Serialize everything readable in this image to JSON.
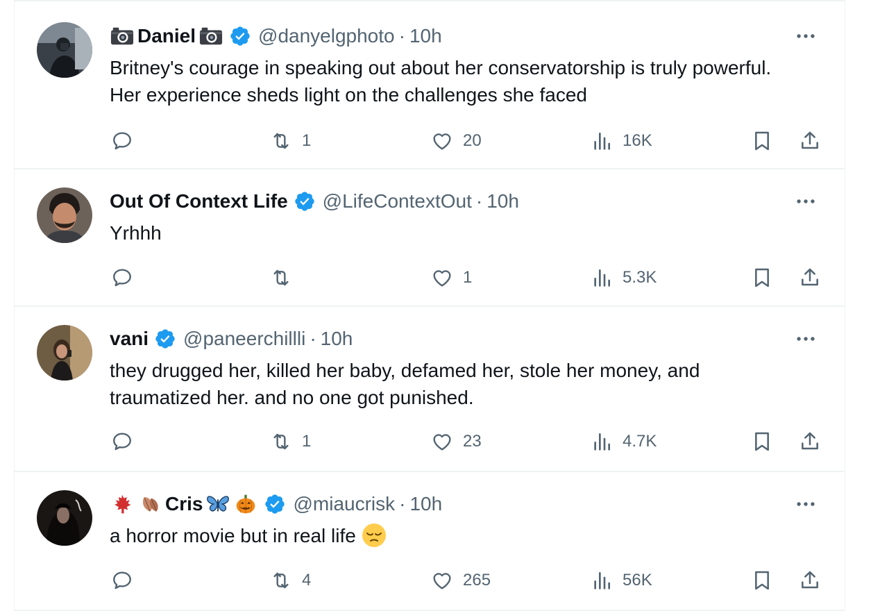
{
  "colors": {
    "text": "#0f1419",
    "muted": "#536471",
    "verified": "#1d9bf0",
    "border": "#eff3f4"
  },
  "icons": {
    "reply": "reply-icon",
    "retweet": "retweet-icon",
    "like": "heart-icon",
    "views": "views-chart-icon",
    "bookmark": "bookmark-icon",
    "share": "share-icon",
    "more": "more-icon",
    "verified": "verified-badge-icon"
  },
  "tweets": [
    {
      "name": "Daniel",
      "name_prefix_emoji": [
        "camera-emoji"
      ],
      "name_suffix_emoji": [
        "camera-emoji"
      ],
      "verified": true,
      "handle": "@danyelgphoto",
      "separator": "·",
      "time": "10h",
      "text": "Britney's courage in speaking out about her conservatorship is truly powerful. Her experience sheds light on the challenges she faced",
      "retweets": "1",
      "likes": "20",
      "views": "16K"
    },
    {
      "name": "Out Of Context Life",
      "verified": true,
      "handle": "@LifeContextOut",
      "separator": "·",
      "time": "10h",
      "text": "Yrhhh",
      "retweets": "",
      "likes": "1",
      "views": "5.3K"
    },
    {
      "name": "vani",
      "verified": true,
      "handle": "@paneerchillli",
      "separator": "·",
      "time": "10h",
      "text": "they drugged her, killed her baby, defamed her, stole her money, and traumatized her. and no one got punished.",
      "retweets": "1",
      "likes": "23",
      "views": "4.7K"
    },
    {
      "name": "Cris",
      "name_prefix_emoji": [
        "maple-leaf-emoji",
        "fallen-leaf-emoji"
      ],
      "name_suffix_emoji": [
        "butterfly-emoji",
        "jack-o-lantern-emoji"
      ],
      "verified": true,
      "handle": "@miaucrisk",
      "separator": "·",
      "time": "10h",
      "text": "a horror movie but in real life",
      "text_emoji": "pensive-face-emoji",
      "retweets": "4",
      "likes": "265",
      "views": "56K"
    }
  ]
}
